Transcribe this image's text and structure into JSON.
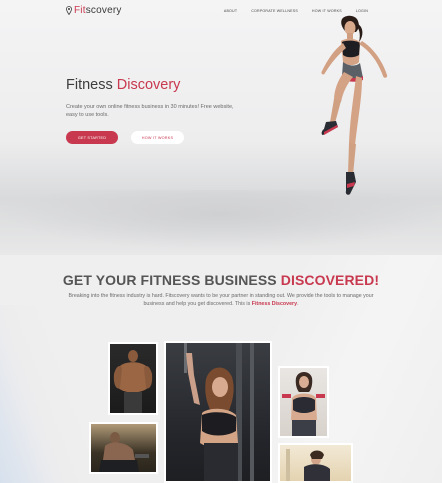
{
  "nav": {
    "logo_prefix": "Fit",
    "logo_suffix": "scovery",
    "links": [
      "ABOUT",
      "CORPORATE WELLNESS",
      "HOW IT WORKS",
      "LOGIN"
    ]
  },
  "hero": {
    "title_plain": "Fitness",
    "title_accent": "Discovery",
    "description": "Create your own online fitness business in 30 minutes! Free website, easy to use tools.",
    "primary_button": "GET STARTED",
    "secondary_button": "HOW IT WORKS"
  },
  "section": {
    "title_plain": "GET YOUR FITNESS BUSINESS",
    "title_accent": "DISCOVERED!",
    "text_plain": "Breaking into the fitness industry is hard. Fitscovery wants to be your partner in standing out. We provide the tools to manage your business and help you get discovered. This is",
    "text_accent": "Fitness Discovery",
    "text_end": "."
  },
  "colors": {
    "accent": "#c8384e",
    "text": "#3d3d3d",
    "background": "#efefef"
  },
  "icons": [
    "map-pin-icon"
  ]
}
